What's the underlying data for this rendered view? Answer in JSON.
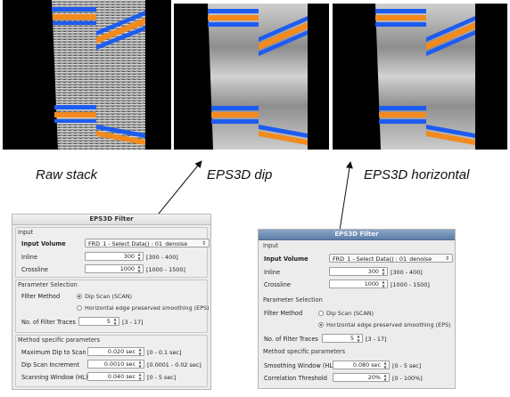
{
  "captions": {
    "raw": "Raw stack",
    "dip": "EPS3D dip",
    "horizontal": "EPS3D horizontal"
  },
  "colors": {
    "blue_event": "#1e5cf0",
    "orange_event": "#f28a1e",
    "panel_bg": "#000000",
    "dialog_title_blue": "#6f8db5"
  },
  "dialog_left": {
    "title": "EPS3D Filter",
    "input_section": "Input",
    "input_volume_label": "Input Volume",
    "input_volume_value": "FRD_1 - Select Data() : 01_denoise",
    "inline_label": "Inline",
    "inline_value": "300",
    "inline_range": "[300 - 400]",
    "crossline_label": "Crossline",
    "crossline_value": "1000",
    "crossline_range": "[1000 - 1500]",
    "param_section": "Parameter Selection",
    "filter_method_label": "Filter Method",
    "method_dip": "Dip Scan (SCAN)",
    "method_eps": "Horizontal edge preserved smoothing (EPS)",
    "selected_method": "dip",
    "num_traces_label": "No. of Filter Traces",
    "num_traces_value": "5",
    "num_traces_range": "[3 - 17]",
    "method_section": "Method specific parameters",
    "max_dip_label": "Maximum Dip to Scan",
    "max_dip_value": "0.020 sec",
    "max_dip_range": "[0 - 0.1 sec]",
    "dip_inc_label": "Dip Scan Increment",
    "dip_inc_value": "0.0010 sec",
    "dip_inc_range": "[0.0001 - 0.02 sec]",
    "scan_win_label": "Scanning Window (HL)",
    "scan_win_value": "0.040 sec",
    "scan_win_range": "[0 - 5 sec]"
  },
  "dialog_right": {
    "title": "EPS3D Filter",
    "input_section": "Input",
    "input_volume_label": "Input Volume",
    "input_volume_value": "FRD_1 - Select Data() : 01_denoise",
    "inline_label": "Inline",
    "inline_value": "300",
    "inline_range": "[300 - 400]",
    "crossline_label": "Crossline",
    "crossline_value": "1000",
    "crossline_range": "[1000 - 1500]",
    "param_section": "Parameter Selection",
    "filter_method_label": "Filter Method",
    "method_dip": "Dip Scan (SCAN)",
    "method_eps": "Horizontal edge preserved smoothing (EPS)",
    "selected_method": "eps",
    "num_traces_label": "No. of Filter Traces",
    "num_traces_value": "5",
    "num_traces_range": "[3 - 17]",
    "method_section": "Method specific parameters",
    "smooth_win_label": "Smoothing Window (HL)",
    "smooth_win_value": "0.080 sec",
    "smooth_win_range": "[0 - 5 sec]",
    "corr_label": "Correlation Threshold",
    "corr_value": "20%",
    "corr_range": "[0 - 100%]"
  }
}
